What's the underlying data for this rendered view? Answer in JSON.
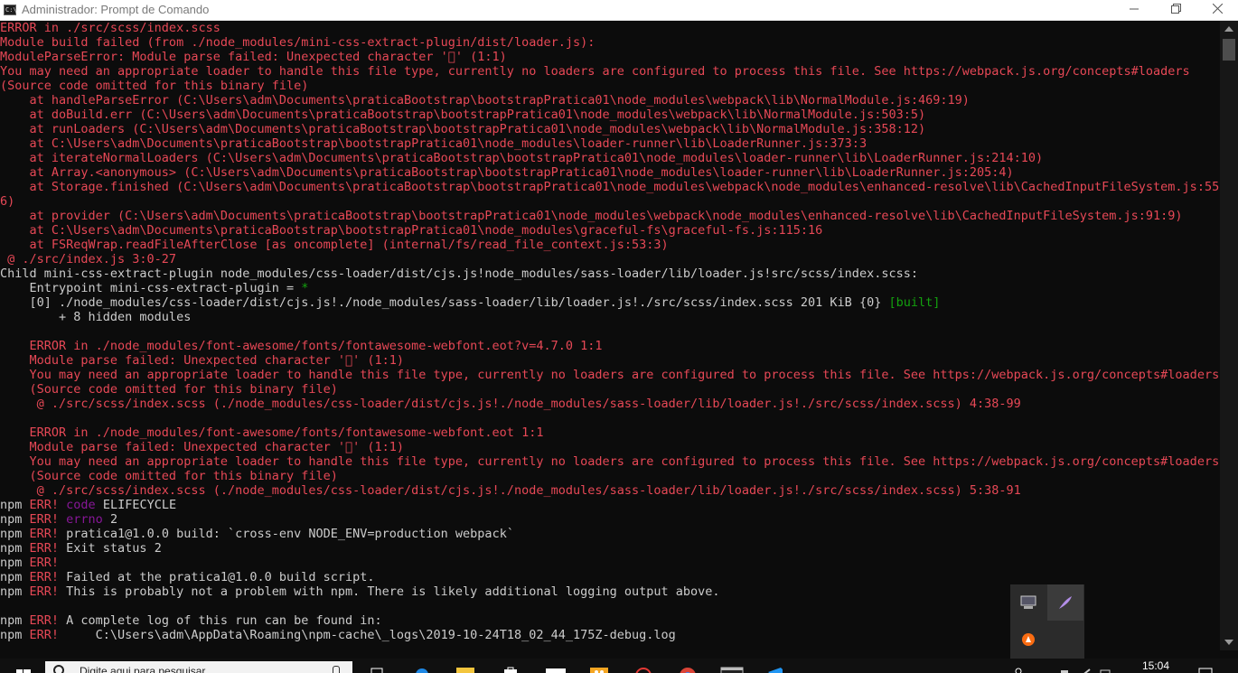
{
  "window": {
    "title": "Administrador: Prompt de Comando",
    "icon": "terminal-icon",
    "buttons": [
      "minimize-icon",
      "restore-icon",
      "close-icon"
    ]
  },
  "colors": {
    "background": "#0c0c0c",
    "text": "#cccccc",
    "error": "#e74856",
    "success": "#13a10e",
    "magenta": "#881798"
  },
  "console": {
    "lines": [
      [
        {
          "t": "ERROR in ./src/scss/index.scss",
          "c": "r"
        }
      ],
      [
        {
          "t": "Module build failed (from ./node_modules/mini-css-extract-plugin/dist/loader.js):",
          "c": "r"
        }
      ],
      [
        {
          "t": "ModuleParseError: Module parse failed: Unexpected character '\u0000' (1:1)",
          "c": "r"
        }
      ],
      [
        {
          "t": "You may need an appropriate loader to handle this file type, currently no loaders are configured to process this file. See https://webpack.js.org/concepts#loaders",
          "c": "r"
        }
      ],
      [
        {
          "t": "(Source code omitted for this binary file)",
          "c": "r"
        }
      ],
      [
        {
          "t": "    at handleParseError (C:\\Users\\adm\\Documents\\praticaBootstrap\\bootstrapPratica01\\node_modules\\webpack\\lib\\NormalModule.js:469:19)",
          "c": "r"
        }
      ],
      [
        {
          "t": "    at doBuild.err (C:\\Users\\adm\\Documents\\praticaBootstrap\\bootstrapPratica01\\node_modules\\webpack\\lib\\NormalModule.js:503:5)",
          "c": "r"
        }
      ],
      [
        {
          "t": "    at runLoaders (C:\\Users\\adm\\Documents\\praticaBootstrap\\bootstrapPratica01\\node_modules\\webpack\\lib\\NormalModule.js:358:12)",
          "c": "r"
        }
      ],
      [
        {
          "t": "    at C:\\Users\\adm\\Documents\\praticaBootstrap\\bootstrapPratica01\\node_modules\\loader-runner\\lib\\LoaderRunner.js:373:3",
          "c": "r"
        }
      ],
      [
        {
          "t": "    at iterateNormalLoaders (C:\\Users\\adm\\Documents\\praticaBootstrap\\bootstrapPratica01\\node_modules\\loader-runner\\lib\\LoaderRunner.js:214:10)",
          "c": "r"
        }
      ],
      [
        {
          "t": "    at Array.<anonymous> (C:\\Users\\adm\\Documents\\praticaBootstrap\\bootstrapPratica01\\node_modules\\loader-runner\\lib\\LoaderRunner.js:205:4)",
          "c": "r"
        }
      ],
      [
        {
          "t": "    at Storage.finished (C:\\Users\\adm\\Documents\\praticaBootstrap\\bootstrapPratica01\\node_modules\\webpack\\node_modules\\enhanced-resolve\\lib\\CachedInputFileSystem.js:55:1",
          "c": "r"
        }
      ],
      [
        {
          "t": "6)",
          "c": "r"
        }
      ],
      [
        {
          "t": "    at provider (C:\\Users\\adm\\Documents\\praticaBootstrap\\bootstrapPratica01\\node_modules\\webpack\\node_modules\\enhanced-resolve\\lib\\CachedInputFileSystem.js:91:9)",
          "c": "r"
        }
      ],
      [
        {
          "t": "    at C:\\Users\\adm\\Documents\\praticaBootstrap\\bootstrapPratica01\\node_modules\\graceful-fs\\graceful-fs.js:115:16",
          "c": "r"
        }
      ],
      [
        {
          "t": "    at FSReqWrap.readFileAfterClose [as oncomplete] (internal/fs/read_file_context.js:53:3)",
          "c": "r"
        }
      ],
      [
        {
          "t": " @ ./src/index.js 3:0-27",
          "c": "r"
        }
      ],
      [
        {
          "t": "Child mini-css-extract-plugin node_modules/css-loader/dist/cjs.js!node_modules/sass-loader/lib/loader.js!src/scss/index.scss:",
          "c": "w"
        }
      ],
      [
        {
          "t": "    Entrypoint mini-css-extract-plugin = ",
          "c": "w"
        },
        {
          "t": "*",
          "c": "g"
        }
      ],
      [
        {
          "t": "    [0] ./node_modules/css-loader/dist/cjs.js!./node_modules/sass-loader/lib/loader.js!./src/scss/index.scss 201 KiB {0} ",
          "c": "w"
        },
        {
          "t": "[built]",
          "c": "g"
        }
      ],
      [
        {
          "t": "        + 8 hidden modules",
          "c": "w"
        }
      ],
      [],
      [
        {
          "t": "    ERROR in ./node_modules/font-awesome/fonts/fontawesome-webfont.eot?v=4.7.0 1:1",
          "c": "r"
        }
      ],
      [
        {
          "t": "    Module parse failed: Unexpected character '\u0000' (1:1)",
          "c": "r"
        }
      ],
      [
        {
          "t": "    You may need an appropriate loader to handle this file type, currently no loaders are configured to process this file. See https://webpack.js.org/concepts#loaders",
          "c": "r"
        }
      ],
      [
        {
          "t": "    (Source code omitted for this binary file)",
          "c": "r"
        }
      ],
      [
        {
          "t": "     @ ./src/scss/index.scss (./node_modules/css-loader/dist/cjs.js!./node_modules/sass-loader/lib/loader.js!./src/scss/index.scss) 4:38-99",
          "c": "r"
        }
      ],
      [],
      [
        {
          "t": "    ERROR in ./node_modules/font-awesome/fonts/fontawesome-webfont.eot 1:1",
          "c": "r"
        }
      ],
      [
        {
          "t": "    Module parse failed: Unexpected character '\u0000' (1:1)",
          "c": "r"
        }
      ],
      [
        {
          "t": "    You may need an appropriate loader to handle this file type, currently no loaders are configured to process this file. See https://webpack.js.org/concepts#loaders",
          "c": "r"
        }
      ],
      [
        {
          "t": "    (Source code omitted for this binary file)",
          "c": "r"
        }
      ],
      [
        {
          "t": "     @ ./src/scss/index.scss (./node_modules/css-loader/dist/cjs.js!./node_modules/sass-loader/lib/loader.js!./src/scss/index.scss) 5:38-91",
          "c": "r"
        }
      ],
      [
        {
          "t": "npm ",
          "c": "w"
        },
        {
          "t": "ERR!",
          "c": "r"
        },
        {
          "t": " ",
          "c": "w"
        },
        {
          "t": "code",
          "c": "m"
        },
        {
          "t": " ELIFECYCLE",
          "c": "w"
        }
      ],
      [
        {
          "t": "npm ",
          "c": "w"
        },
        {
          "t": "ERR!",
          "c": "r"
        },
        {
          "t": " ",
          "c": "w"
        },
        {
          "t": "errno",
          "c": "m"
        },
        {
          "t": " 2",
          "c": "w"
        }
      ],
      [
        {
          "t": "npm ",
          "c": "w"
        },
        {
          "t": "ERR!",
          "c": "r"
        },
        {
          "t": " pratica1@1.0.0 build: `cross-env NODE_ENV=production webpack`",
          "c": "w"
        }
      ],
      [
        {
          "t": "npm ",
          "c": "w"
        },
        {
          "t": "ERR!",
          "c": "r"
        },
        {
          "t": " Exit status 2",
          "c": "w"
        }
      ],
      [
        {
          "t": "npm ",
          "c": "w"
        },
        {
          "t": "ERR!",
          "c": "r"
        }
      ],
      [
        {
          "t": "npm ",
          "c": "w"
        },
        {
          "t": "ERR!",
          "c": "r"
        },
        {
          "t": " Failed at the pratica1@1.0.0 build script.",
          "c": "w"
        }
      ],
      [
        {
          "t": "npm ",
          "c": "w"
        },
        {
          "t": "ERR!",
          "c": "r"
        },
        {
          "t": " This is probably not a problem with npm. There is likely additional logging output above.",
          "c": "w"
        }
      ],
      [],
      [
        {
          "t": "npm ",
          "c": "w"
        },
        {
          "t": "ERR!",
          "c": "r"
        },
        {
          "t": " A complete log of this run can be found in:",
          "c": "w"
        }
      ],
      [
        {
          "t": "npm ",
          "c": "w"
        },
        {
          "t": "ERR!",
          "c": "r"
        },
        {
          "t": "     C:\\Users\\adm\\AppData\\Roaming\\npm-cache\\_logs\\2019-10-24T18_02_44_175Z-debug.log",
          "c": "w"
        }
      ]
    ]
  },
  "tray_popup": {
    "icons": [
      "monitor-icon",
      "feather-icon",
      "avast-icon"
    ]
  },
  "taskbar": {
    "search_text": "Digite aqui para pesquisar",
    "clock": "15:04",
    "icons": [
      "windows-start-icon",
      "search-icon",
      "task-view-icon",
      "edge-icon",
      "folder-icon",
      "store-icon",
      "mail-icon",
      "mascot-icon",
      "record-icon",
      "chrome-icon",
      "terminal-taskbar-icon",
      "vscode-icon"
    ]
  }
}
